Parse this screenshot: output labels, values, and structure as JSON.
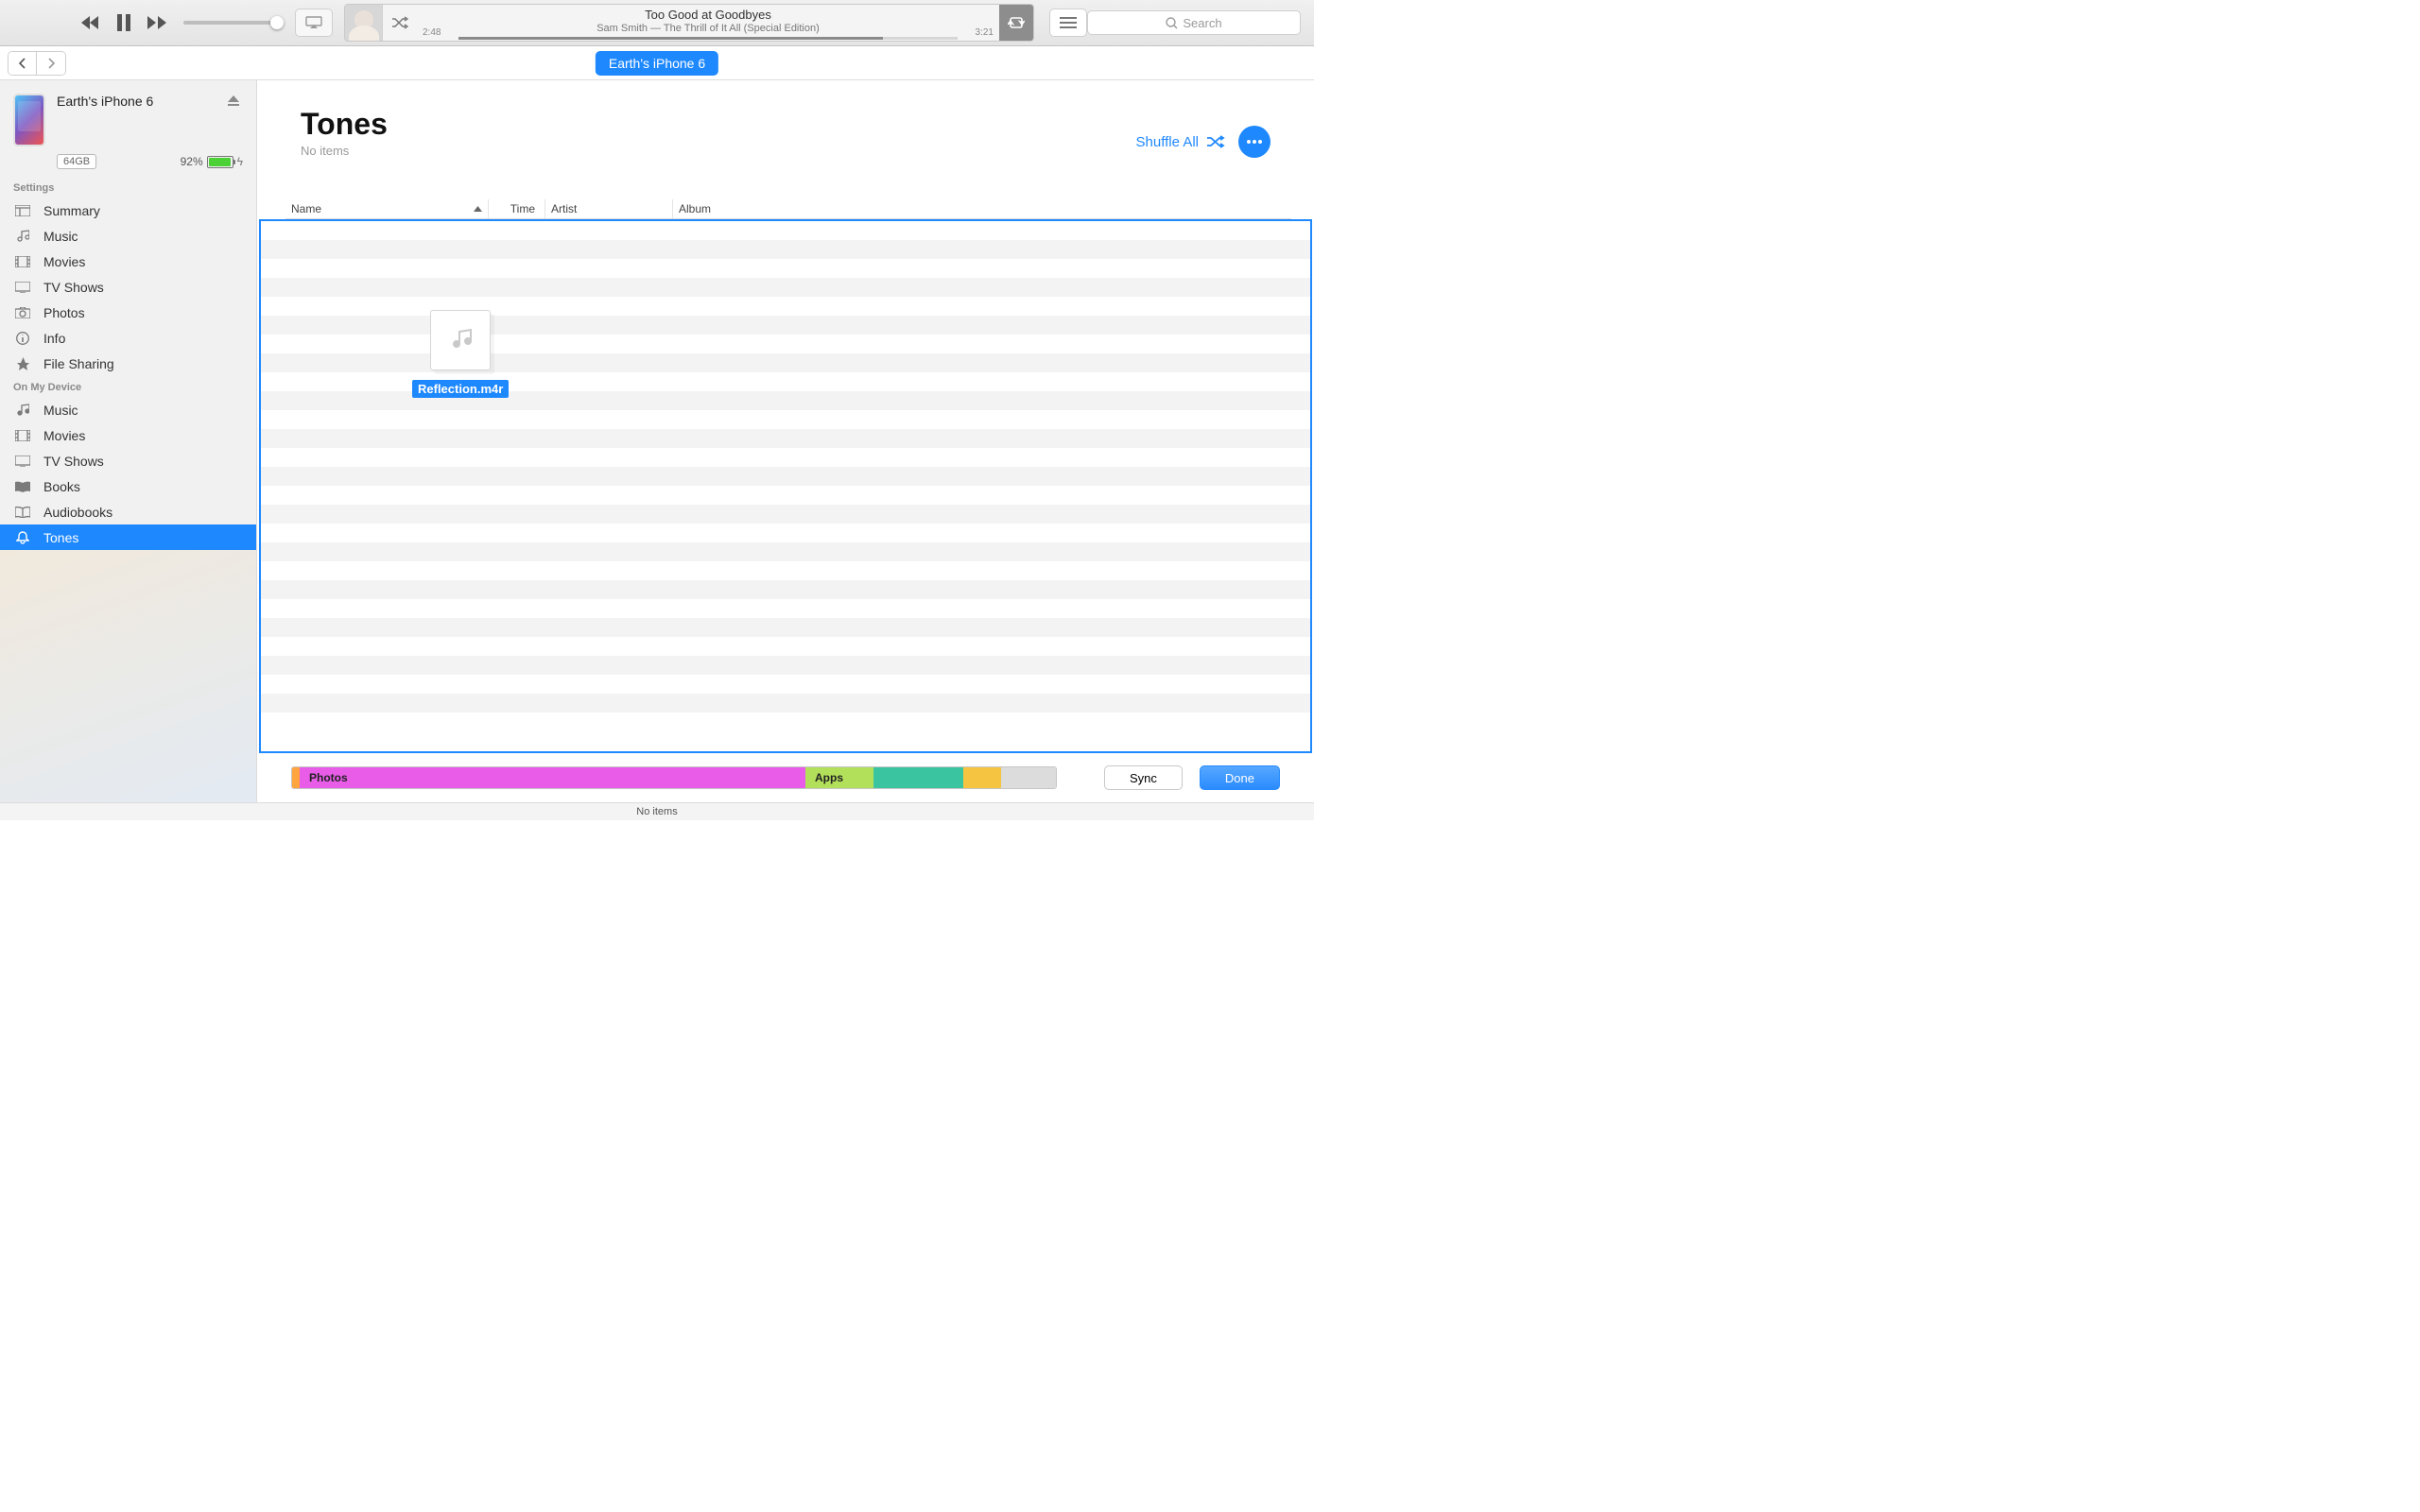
{
  "player": {
    "title": "Too Good at Goodbyes",
    "subtitle": "Sam Smith — The Thrill of It All (Special Edition)",
    "elapsed": "2:48",
    "remaining": "3:21"
  },
  "search_placeholder": "Search",
  "device_tab": "Earth's iPhone 6",
  "device": {
    "name": "Earth's iPhone 6",
    "capacity": "64GB",
    "battery_pct": "92%"
  },
  "sidebar": {
    "section_settings": "Settings",
    "section_device": "On My Device",
    "settings": [
      {
        "label": "Summary"
      },
      {
        "label": "Music"
      },
      {
        "label": "Movies"
      },
      {
        "label": "TV Shows"
      },
      {
        "label": "Photos"
      },
      {
        "label": "Info"
      },
      {
        "label": "File Sharing"
      }
    ],
    "on_device": [
      {
        "label": "Music"
      },
      {
        "label": "Movies"
      },
      {
        "label": "TV Shows"
      },
      {
        "label": "Books"
      },
      {
        "label": "Audiobooks"
      },
      {
        "label": "Tones"
      }
    ]
  },
  "page": {
    "title": "Tones",
    "subtitle": "No items",
    "shuffle_all": "Shuffle All"
  },
  "columns": {
    "name": "Name",
    "time": "Time",
    "artist": "Artist",
    "album": "Album"
  },
  "dragged_file": "Reflection.m4r",
  "storage": {
    "photos_label": "Photos",
    "apps_label": "Apps"
  },
  "buttons": {
    "sync": "Sync",
    "done": "Done"
  },
  "status": "No items"
}
